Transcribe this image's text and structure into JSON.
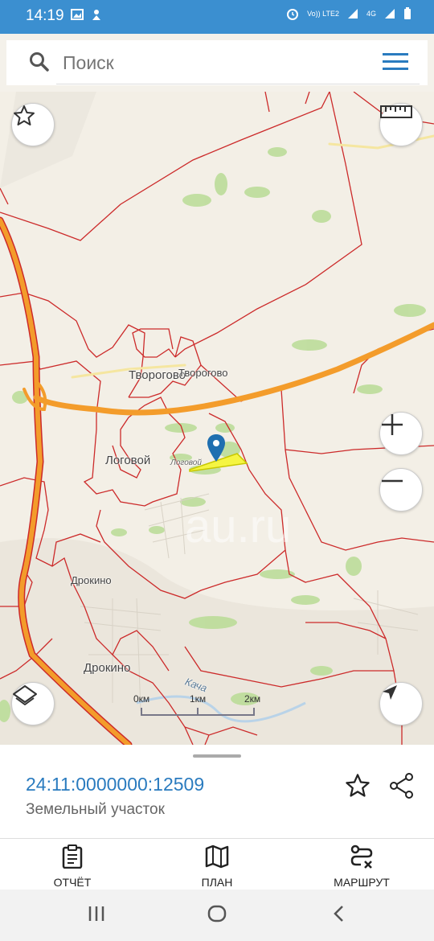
{
  "status_bar": {
    "time": "14:19",
    "network": "Vo)) LTE2",
    "signal": "4G"
  },
  "search": {
    "placeholder": "Поиск"
  },
  "map": {
    "labels": {
      "tvorogovo_short": "Творогово",
      "tvorogovo": "Творогово",
      "logovoy": "Логовой",
      "logovoy_small": "Логовой",
      "drokino_top": "Дрокино",
      "drokino": "Дрокино",
      "kacha": "Кача"
    },
    "scale": {
      "zero": "0км",
      "one": "1км",
      "two": "2км"
    },
    "watermark": "au.ru"
  },
  "parcel": {
    "id": "24:11:0000000:12509",
    "type": "Земельный участок"
  },
  "actions": {
    "report": "ОТЧЁТ",
    "plan": "ПЛАН",
    "route": "МАРШРУТ"
  },
  "colors": {
    "status_bar": "#3b8fd0",
    "accent": "#2a7bbf",
    "road": "#f39c2b",
    "boundary": "#cc2a2a",
    "parcel_fill": "#f5f542"
  }
}
